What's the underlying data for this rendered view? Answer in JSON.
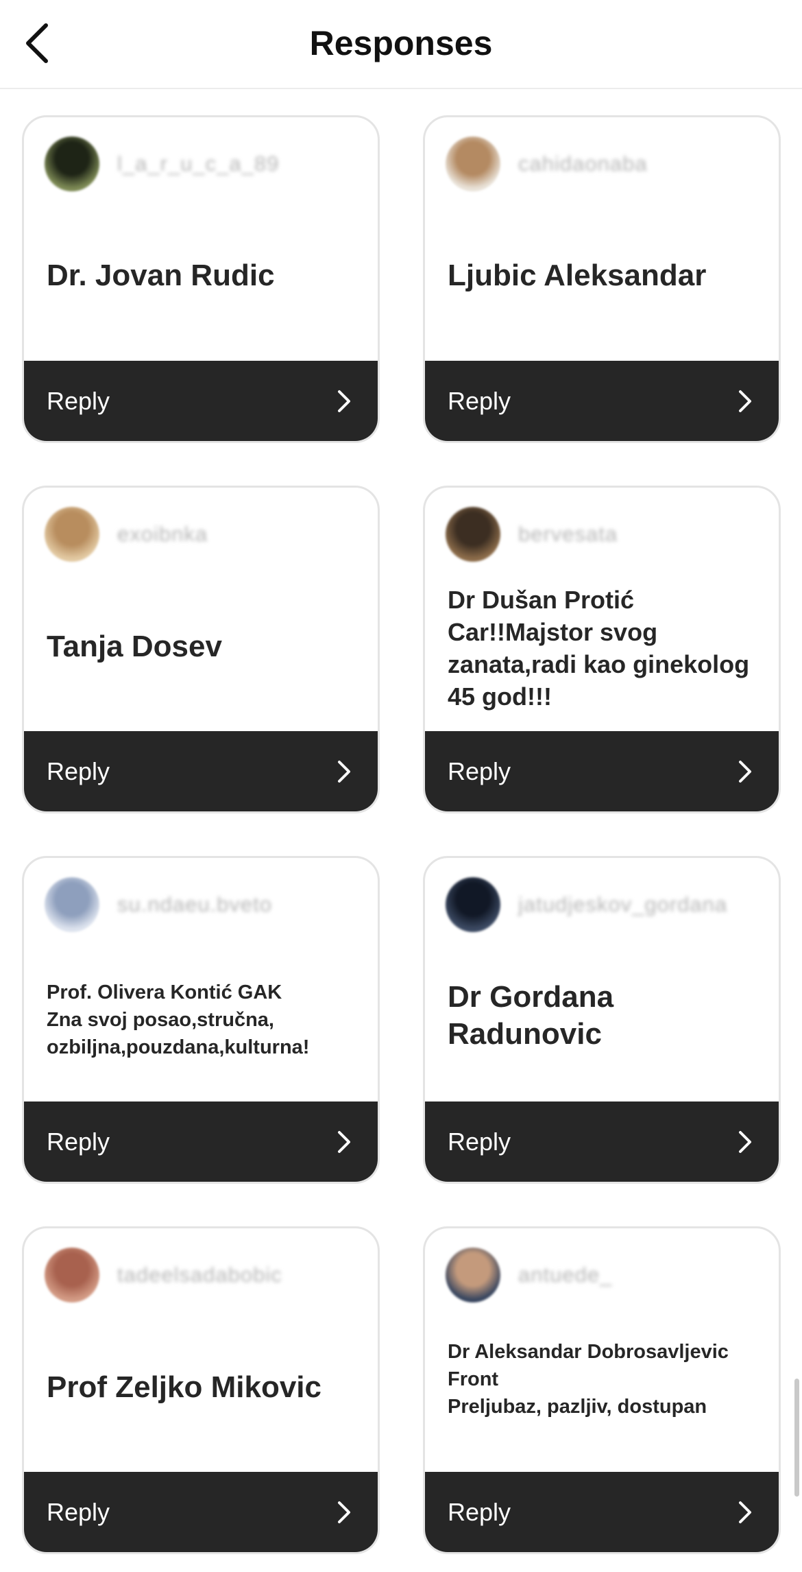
{
  "header": {
    "title": "Responses",
    "back_icon": "chevron-left-icon"
  },
  "reply_label": "Reply",
  "cards": [
    {
      "username": "l_a_r_u_c_a_89",
      "response": "Dr. Jovan Rudic",
      "avatar_colors": [
        "#7d8a55",
        "#1e2416"
      ]
    },
    {
      "username": "cahidaonaba",
      "response": "Ljubic Aleksandar",
      "avatar_colors": [
        "#e9e2d8",
        "#b48a62"
      ]
    },
    {
      "username": "exoibnka",
      "response": "Tanja Dosev",
      "avatar_colors": [
        "#e2c9a2",
        "#b88d5e"
      ]
    },
    {
      "username": "bervesata",
      "response": "Dr Dušan Protić Car!!Majstor svog zanata,radi kao ginekolog 45 god!!!",
      "avatar_colors": [
        "#8c6c4a",
        "#3c2e22"
      ]
    },
    {
      "username": "su.ndaeu.bveto",
      "response": "Prof. Olivera Kontić GAK\nZna svoj posao,stručna, ozbiljna,pouzdana,kulturna!",
      "avatar_colors": [
        "#dde3ee",
        "#8e9fbd"
      ]
    },
    {
      "username": "jatudjeskov_gordana",
      "response": "Dr Gordana Radunovic",
      "avatar_colors": [
        "#3c4a63",
        "#111826"
      ]
    },
    {
      "username": "tadeelsadabobic",
      "response": "Prof Zeljko Mikovic",
      "avatar_colors": [
        "#d39b85",
        "#a8614e"
      ]
    },
    {
      "username": "antuede_",
      "response": "Dr Aleksandar Dobrosavljevic\nFront\nPreljubaz, pazljiv, dostupan",
      "avatar_colors": [
        "#3a4760",
        "#c49a7c"
      ]
    }
  ]
}
